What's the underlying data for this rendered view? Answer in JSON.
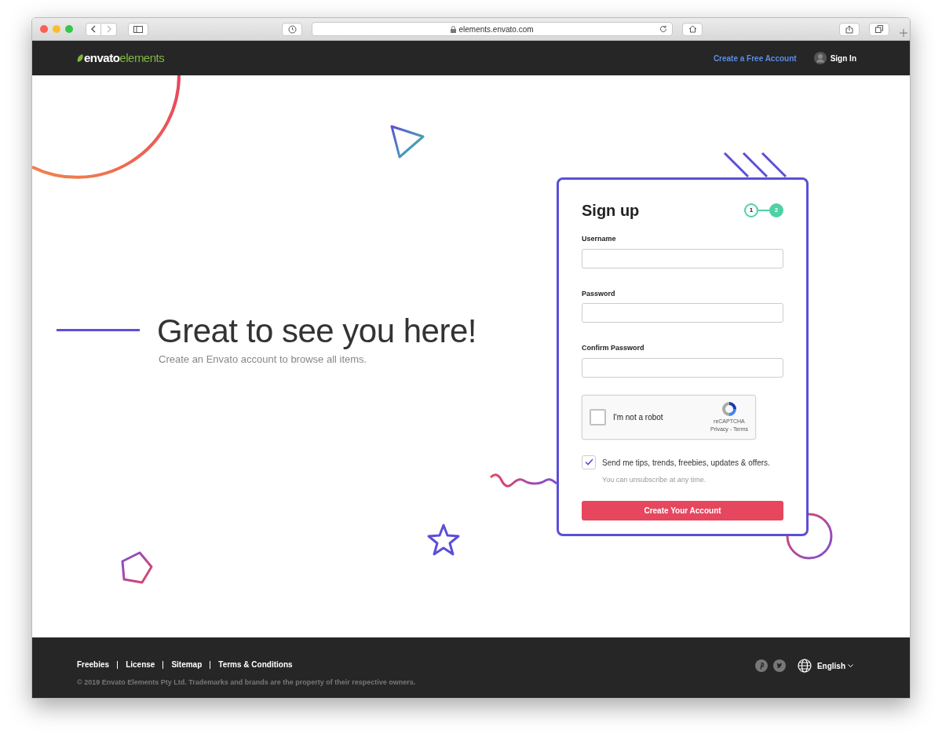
{
  "browser": {
    "url": "elements.envato.com"
  },
  "nav": {
    "logo": [
      "envato",
      "elements"
    ],
    "create_account": "Create a Free Account",
    "sign_in": "Sign In"
  },
  "hero": {
    "title": "Great to see you here!",
    "subtitle": "Create an Envato account to browse all items."
  },
  "form": {
    "title": "Sign up",
    "steps": [
      {
        "label": "1",
        "selected": false
      },
      {
        "label": "2",
        "selected": true
      }
    ],
    "fields": [
      {
        "label": "Username"
      },
      {
        "label": "Password"
      },
      {
        "label": "Confirm Password"
      }
    ],
    "captcha": {
      "label": "I'm not a robot",
      "checked": false,
      "brand": "reCAPTCHA",
      "links": "Privacy - Terms"
    },
    "newsletter": {
      "checked": true,
      "label": "Send me tips, trends, freebies, updates & offers.",
      "note": "You can unsubscribe at any time."
    },
    "submit": "Create Your Account"
  },
  "footer": {
    "links": [
      "Freebies",
      "License",
      "Sitemap",
      "Terms & Conditions"
    ],
    "copyright": "© 2019 Envato Elements Pty Ltd. Trademarks and brands are the property of their respective owners.",
    "language": "English"
  }
}
